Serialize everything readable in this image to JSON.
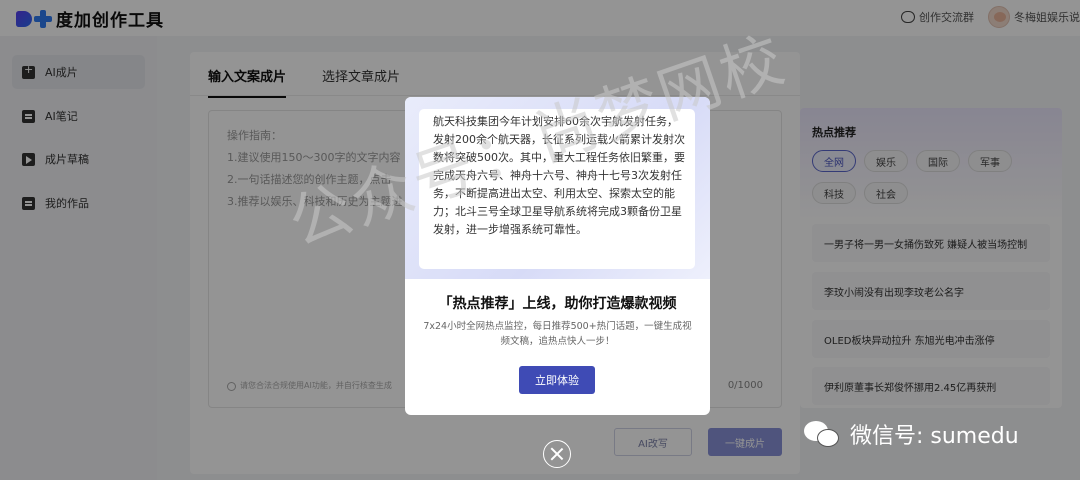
{
  "header": {
    "app_name": "度加创作工具",
    "community": "创作交流群",
    "user_name": "冬梅姐娱乐说"
  },
  "sidebar": {
    "items": [
      {
        "label": "AI成片",
        "icon": "ai-plus-icon"
      },
      {
        "label": "AI笔记",
        "icon": "note-icon"
      },
      {
        "label": "成片草稿",
        "icon": "play-icon"
      },
      {
        "label": "我的作品",
        "icon": "check-icon"
      }
    ]
  },
  "main": {
    "tabs": [
      {
        "label": "输入文案成片"
      },
      {
        "label": "选择文章成片"
      }
    ],
    "guide": {
      "title": "操作指南：",
      "lines": [
        "1.建议使用150～300字的文字内容",
        "2.一句话描述您的创作主题，点击",
        "3.推荐以娱乐、科技和历史为主题进"
      ]
    },
    "footer_note": "请您合法合规使用AI功能，并自行核查生成",
    "counter": "0/1000",
    "ai_rewrite_label": "AI改写",
    "generate_label": "一键成片"
  },
  "hot": {
    "title": "热点推荐",
    "chips": [
      "全网",
      "娱乐",
      "国际",
      "军事",
      "科技",
      "社会"
    ],
    "items": [
      "一男子将一男一女捅伤致死 嫌疑人被当场控制",
      "李玟小闹没有出现李玟老公名字",
      "OLED板块异动拉升 东旭光电冲击涨停",
      "伊利原董事长郑俊怀挪用2.45亿再获刑"
    ]
  },
  "modal": {
    "article": "航天科技集团今年计划安排60余次宇航发射任务，发射200余个航天器，长征系列运载火箭累计发射次数将突破500次。其中，重大工程任务依旧繁重，要完成天舟六号、神舟十六号、神舟十七号3次发射任务，不断提高进出太空、利用太空、探索太空的能力；北斗三号全球卫星导航系统将完成3颗备份卫星发射，进一步增强系统可靠性。",
    "title": "「热点推荐」上线，助你打造爆款视频",
    "desc": "7x24小时全网热点监控，每日推荐500+热门话题，一键生成视频文稿，追热点快人一步！",
    "button": "立即体验"
  },
  "watermark": {
    "text": "公众号：尚梦网校",
    "wechat": "微信号: sumedu"
  }
}
